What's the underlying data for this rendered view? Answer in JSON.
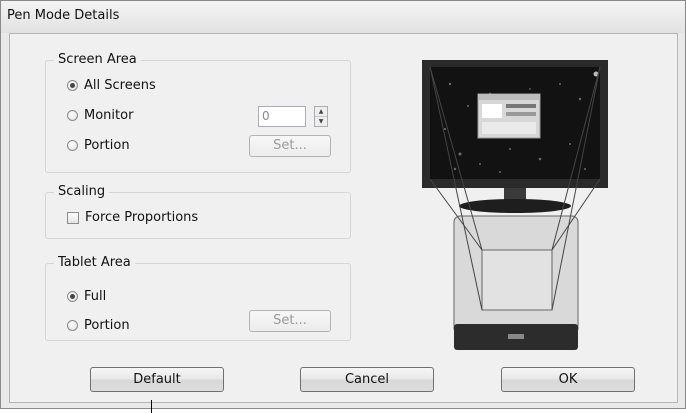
{
  "window": {
    "title": "Pen Mode Details"
  },
  "screen_area": {
    "title": "Screen Area",
    "options": [
      "All Screens",
      "Monitor",
      "Portion"
    ],
    "selected": "All Screens",
    "monitor_value": "0",
    "set_label": "Set..."
  },
  "scaling": {
    "title": "Scaling",
    "force_proportions_label": "Force Proportions",
    "force_proportions_checked": false
  },
  "tablet_area": {
    "title": "Tablet Area",
    "options": [
      "Full",
      "Portion"
    ],
    "selected": "Full",
    "set_label": "Set..."
  },
  "buttons": {
    "default": "Default",
    "cancel": "Cancel",
    "ok": "OK"
  }
}
